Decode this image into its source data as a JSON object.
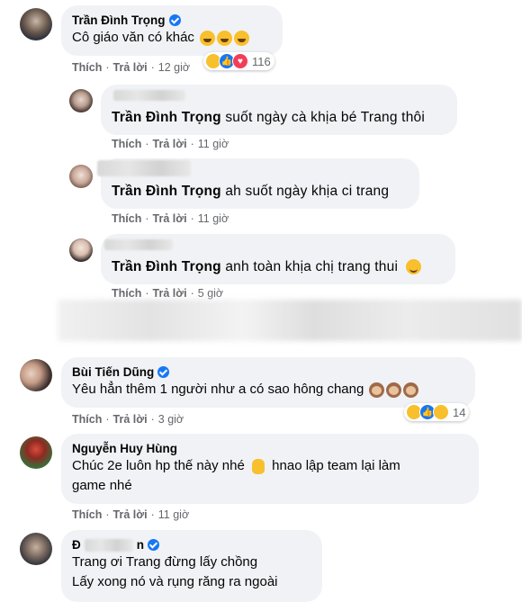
{
  "colors": {
    "bubble": "#f0f2f5",
    "meta": "#65676b",
    "verified": "#1877f2"
  },
  "comments": [
    {
      "author": "Trần Đình Trọng",
      "verified": true,
      "text": "Cô giáo văn có khác",
      "emoji": [
        "haha-emoji",
        "haha-emoji",
        "haha-emoji"
      ],
      "like": "Thích",
      "reply": "Trả lời",
      "time": "12 giờ",
      "reactions": [
        "haha",
        "like",
        "love"
      ],
      "reaction_count": "116"
    },
    {
      "author": "",
      "mention": "Trần Đình Trọng",
      "text": "suốt ngày cà khịa bé Trang thôi",
      "like": "Thích",
      "reply": "Trả lời",
      "time": "11 giờ"
    },
    {
      "author": "",
      "mention": "Trần Đình Trọng",
      "text": "ah suốt ngày khịa ci trang",
      "like": "Thích",
      "reply": "Trả lời",
      "time": "11 giờ"
    },
    {
      "author": "",
      "mention": "Trần Đình Trọng",
      "text": "anh toàn khịa chị trang thui",
      "emoji": [
        "wink-emoji"
      ],
      "like": "Thích",
      "reply": "Trả lời",
      "time": "5 giờ"
    },
    {
      "author": "Bùi Tiến Dũng",
      "verified": true,
      "text": "Yêu hẳn thêm 1 người như a có sao hông chang",
      "emoji": [
        "see-no-evil-monkey",
        "see-no-evil-monkey",
        "see-no-evil-monkey"
      ],
      "like": "Thích",
      "reply": "Trả lời",
      "time": "3 giờ",
      "reactions": [
        "haha",
        "like",
        "sad"
      ],
      "reaction_count": "14"
    },
    {
      "author": "Nguyễn Huy Hùng",
      "verified": false,
      "text_line1_a": "Chúc 2e luôn hp thế này nhé",
      "text_line1_b": "hnao lập team lại làm",
      "text_line2": "game nhé",
      "emoji": [
        "victory-hand"
      ],
      "like": "Thích",
      "reply": "Trả lời",
      "time": "11 giờ"
    },
    {
      "author_initial": "Đ",
      "author_end": "n",
      "verified": true,
      "text_line1": "Trang ơi Trang đừng lấy chồng",
      "text_line2": "Lấy xong nó và rụng răng ra ngoài"
    }
  ]
}
